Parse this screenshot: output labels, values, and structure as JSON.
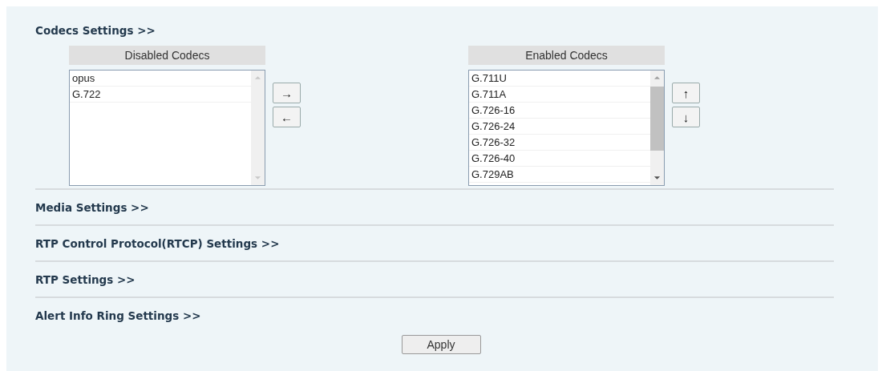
{
  "codecs_section": {
    "title": "Codecs Settings >>",
    "disabled_codecs": {
      "header": "Disabled Codecs",
      "items": [
        "opus",
        "G.722"
      ]
    },
    "move_buttons": [
      "→",
      "←"
    ],
    "enabled_codecs": {
      "header": "Enabled Codecs",
      "items": [
        "G.711U",
        "G.711A",
        "G.726-16",
        "G.726-24",
        "G.726-32",
        "G.726-40",
        "G.729AB"
      ]
    },
    "order_buttons": [
      "↑",
      "↓"
    ]
  },
  "sections": [
    "Media Settings >>",
    "RTP Control Protocol(RTCP) Settings >>",
    "RTP Settings >>",
    "Alert Info Ring Settings >>"
  ],
  "apply_button": "Apply"
}
